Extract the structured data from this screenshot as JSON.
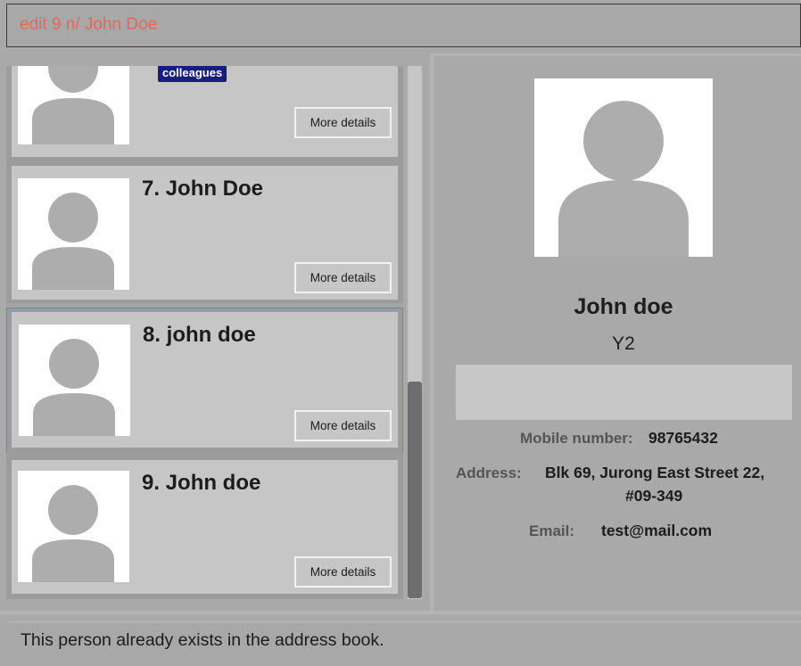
{
  "command_box": {
    "input_value": "edit 9 n/ John Doe"
  },
  "person_list": {
    "cards": [
      {
        "name": "",
        "tags": [
          "colleagues"
        ],
        "more_label": "More details"
      },
      {
        "name": "7. John Doe",
        "tags": [],
        "more_label": "More details"
      },
      {
        "name": "8. john doe",
        "tags": [],
        "more_label": "More details",
        "selected": true
      },
      {
        "name": "9. John doe",
        "tags": [],
        "more_label": "More details"
      }
    ]
  },
  "detail_panel": {
    "name": "John doe",
    "year": "Y2",
    "mobile_label": "Mobile number:",
    "mobile_value": "98765432",
    "address_label": "Address:",
    "address_line1": "Blk 69, Jurong East Street 22,",
    "address_line2": "#09-349",
    "email_label": "Email:",
    "email_value": "test@mail.com"
  },
  "result_display": {
    "text": "This person already exists in the address book."
  },
  "colors": {
    "background": "#a9a9a9",
    "card": "#c6c6c6",
    "tag": "#161f7c",
    "command_text": "#e06a5a"
  }
}
